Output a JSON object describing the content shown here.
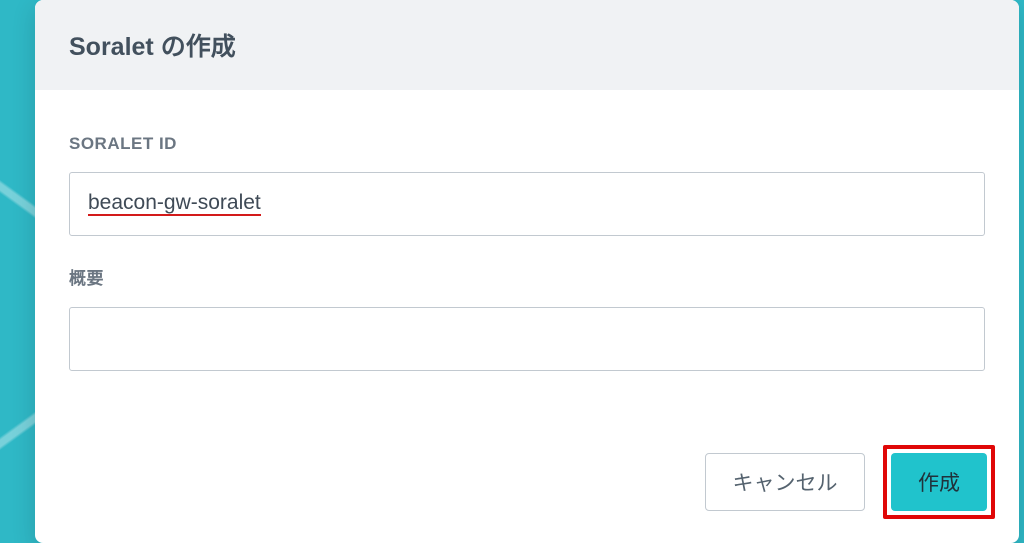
{
  "dialog": {
    "title": "Soralet の作成",
    "fields": {
      "soralet_id": {
        "label": "SORALET ID",
        "value": "beacon-gw-soralet"
      },
      "summary": {
        "label": "概要",
        "value": ""
      }
    },
    "buttons": {
      "cancel": "キャンセル",
      "create": "作成"
    }
  }
}
